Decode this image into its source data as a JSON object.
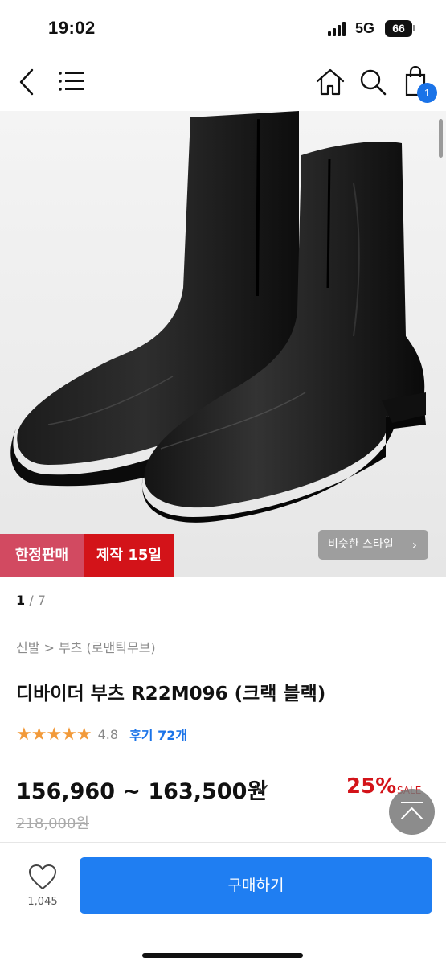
{
  "status_bar": {
    "time": "19:02",
    "network": "5G",
    "battery": "66"
  },
  "nav": {
    "back_icon": "chevron-left-icon",
    "menu_icon": "hamburger-menu-icon",
    "home_icon": "home-icon",
    "search_icon": "search-icon",
    "cart_icon": "shopping-bag-icon",
    "cart_count": "1",
    "accent_color": "#1a73e8"
  },
  "product_image": {
    "badges": {
      "limited": "한정판매",
      "production": "제작 15일"
    },
    "similar_style_label": "비슷한 스타일",
    "page_current": "1",
    "page_total": "/ 7",
    "badge_colors": {
      "limited": "#d24a61",
      "production": "#d31319"
    }
  },
  "product": {
    "breadcrumb": "신발 > 부츠 (로맨틱무브)",
    "title": "디바이더 부츠 R22M096 (크랙 블랙)",
    "rating_stars": "★★★★★",
    "rating_value_num": 4.8,
    "rating_value": "4.8",
    "review_link": "후기 72개",
    "price_range": "156,960 ~ 163,500원",
    "discount": "25%",
    "sale_label": "SALE",
    "original_price": "218,000원",
    "star_color": "#f29a3a",
    "discount_color": "#d31319"
  },
  "bottom_bar": {
    "like_icon": "heart-outline-icon",
    "like_count": "1,045",
    "buy_label": "구매하기",
    "buy_color": "#1f7ef2"
  }
}
